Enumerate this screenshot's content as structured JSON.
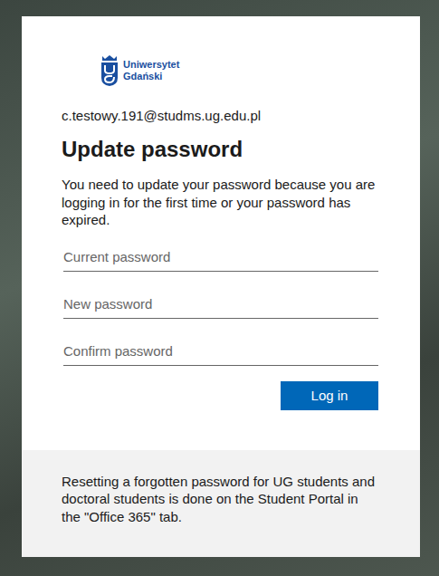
{
  "logo": {
    "line1": "Uniwersytet",
    "line2": "Gdański"
  },
  "account": "c.testowy.191@studms.ug.edu.pl",
  "title": "Update password",
  "description": "You need to update your password because you are logging in for the first time or your password has expired.",
  "fields": [
    {
      "placeholder": "Current password"
    },
    {
      "placeholder": "New password"
    },
    {
      "placeholder": "Confirm password"
    }
  ],
  "buttons": [
    "Log in"
  ],
  "footer": "Resetting a forgotten password for UG students and doctoral students is done on the Student Portal in the \"Office 365\" tab."
}
